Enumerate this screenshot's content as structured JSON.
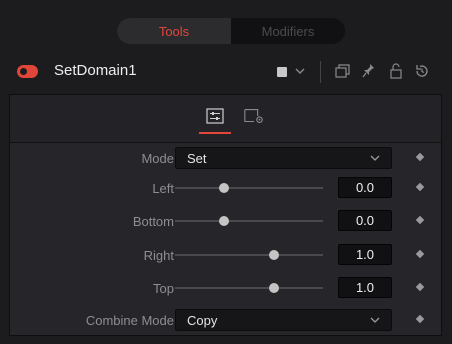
{
  "tabs": {
    "tools_label": "Tools",
    "modifiers_label": "Modifiers"
  },
  "tool": {
    "name": "SetDomain1",
    "swatch_color": "#c8c8c8",
    "enabled": true
  },
  "header_icons": [
    "color-swatch-icon",
    "chevron-down-icon",
    "copy-icon",
    "pin-icon",
    "lock-icon",
    "reset-icon"
  ],
  "panel_tabs": [
    "sliders-icon",
    "gear-settings-icon"
  ],
  "controls": {
    "mode": {
      "label": "Mode",
      "value": "Set"
    },
    "left": {
      "label": "Left",
      "value": "0.0",
      "slider_fraction": 0.33
    },
    "bottom": {
      "label": "Bottom",
      "value": "0.0",
      "slider_fraction": 0.33
    },
    "right": {
      "label": "Right",
      "value": "1.0",
      "slider_fraction": 0.67
    },
    "top": {
      "label": "Top",
      "value": "1.0",
      "slider_fraction": 0.67
    },
    "combine_mode": {
      "label": "Combine Mode",
      "value": "Copy"
    }
  },
  "colors": {
    "accent": "#e0463a",
    "background": "#1c1c1e",
    "panel": "#26262a"
  }
}
